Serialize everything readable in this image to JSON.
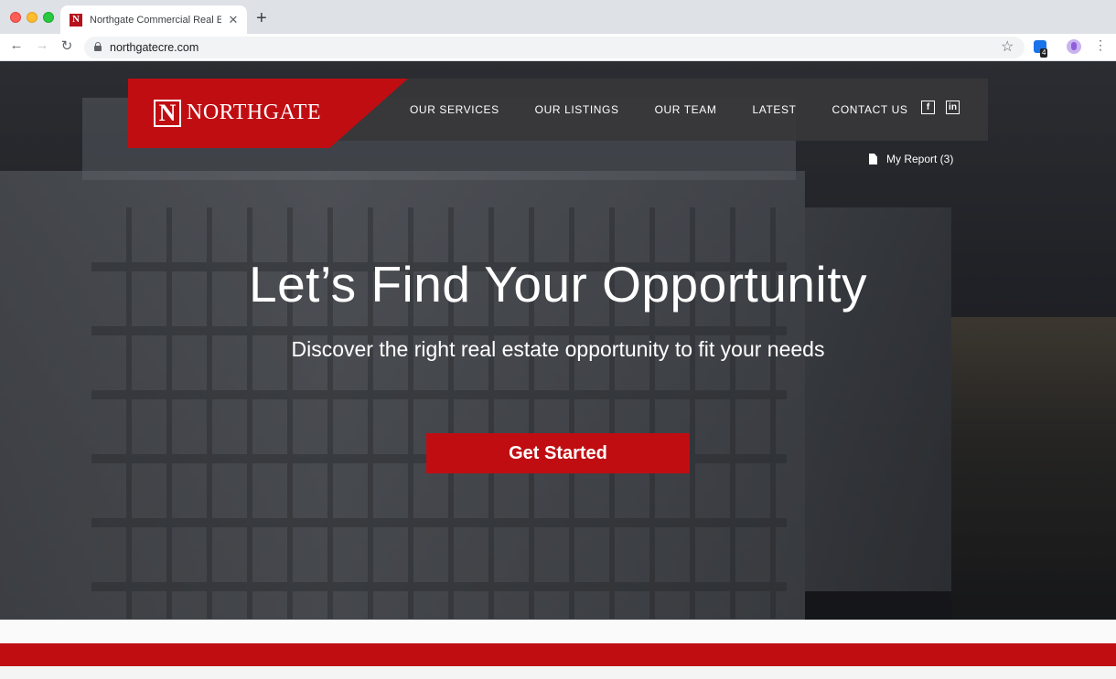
{
  "browser": {
    "tab_title": "Northgate Commercial Real Estate",
    "favicon_letter": "N",
    "close_glyph": "✕",
    "new_tab_glyph": "+",
    "back_glyph": "←",
    "forward_glyph": "→",
    "reload_glyph": "↻",
    "url": "northgatecre.com",
    "star_glyph": "☆",
    "extension_badge": "4",
    "menu_glyph": "⋮"
  },
  "site": {
    "logo_letter": "N",
    "logo_text": "NORTHGATE",
    "accent_color": "#c00d12",
    "nav": [
      {
        "label": "OUR SERVICES"
      },
      {
        "label": "OUR LISTINGS"
      },
      {
        "label": "OUR TEAM"
      },
      {
        "label": "LATEST"
      },
      {
        "label": "CONTACT US"
      }
    ],
    "social": {
      "facebook": "f",
      "linkedin": "in"
    },
    "report_label": "My Report (3)"
  },
  "hero": {
    "headline": "Let’s Find Your Opportunity",
    "subhead": "Discover the right real estate opportunity to fit your needs",
    "cta_label": "Get Started"
  }
}
